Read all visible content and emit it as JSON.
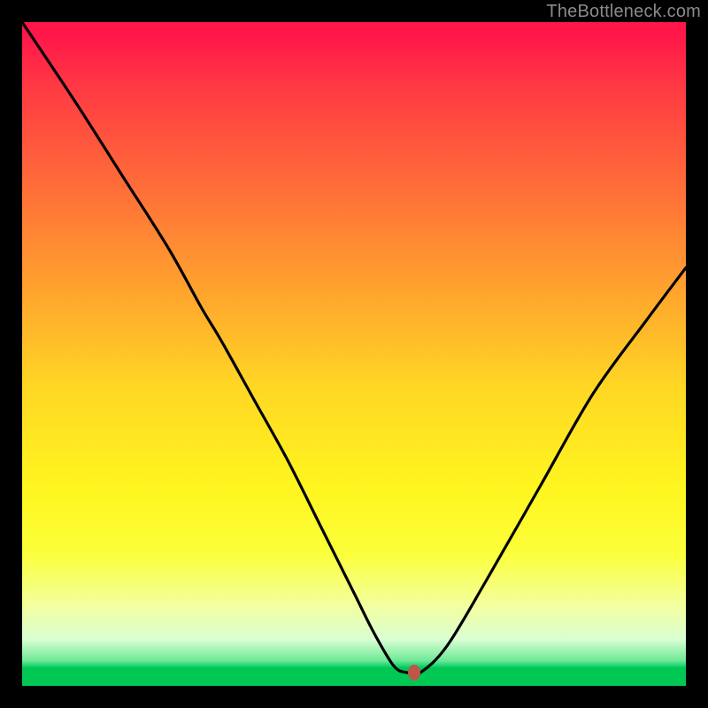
{
  "watermark": "TheBottleneck.com",
  "colors": {
    "frame": "#000000",
    "gradient_top": "#ff1749",
    "gradient_mid": "#ffd724",
    "gradient_bottom": "#00c853",
    "curve": "#000000",
    "marker": "#c0564a"
  },
  "chart_data": {
    "type": "line",
    "title": "",
    "xlabel": "",
    "ylabel": "",
    "xlim": [
      0,
      100
    ],
    "ylim": [
      0,
      100
    ],
    "series": [
      {
        "name": "bottleneck-curve",
        "x": [
          0,
          8,
          15,
          22,
          27,
          30,
          35,
          40,
          45,
          50,
          53,
          56,
          58,
          60,
          64,
          70,
          78,
          86,
          94,
          100
        ],
        "values": [
          100,
          88,
          77,
          66,
          57,
          52,
          43,
          34,
          24,
          14,
          8,
          3,
          2,
          2,
          6,
          16,
          30,
          44,
          55,
          63
        ]
      }
    ],
    "marker": {
      "x": 59,
      "y": 2
    },
    "annotations": []
  }
}
